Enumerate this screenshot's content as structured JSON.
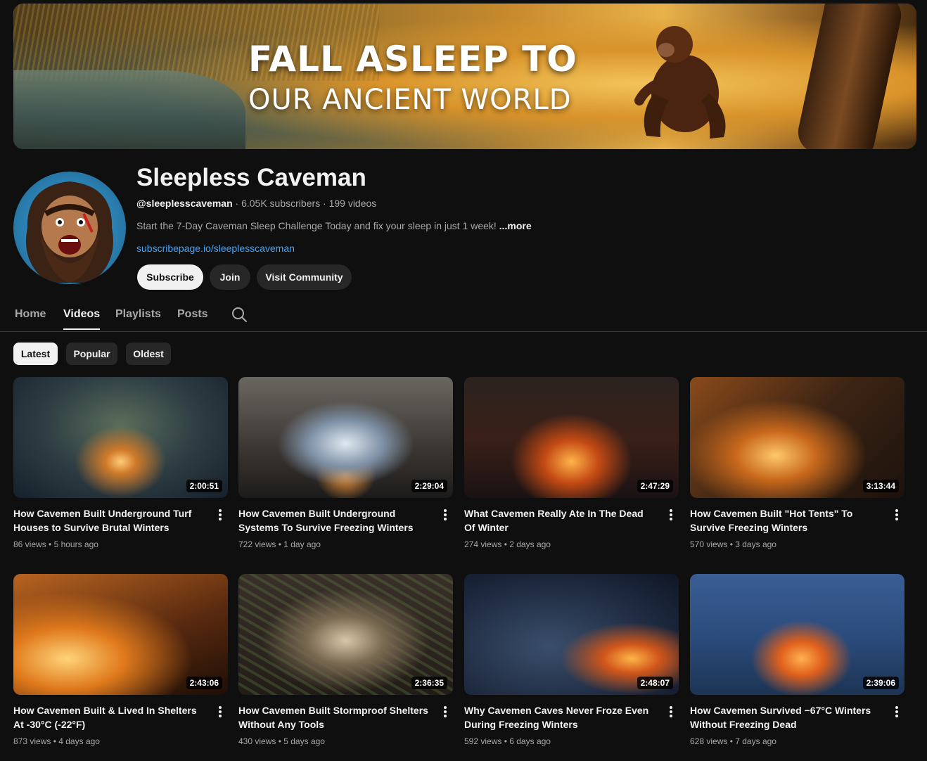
{
  "banner": {
    "line1": "FALL ASLEEP TO",
    "line2": "OUR ANCIENT WORLD"
  },
  "channel": {
    "name": "Sleepless Caveman",
    "handle": "@sleeplesscaveman",
    "stats": " · 6.05K subscribers · 199 videos",
    "description": "Start the 7-Day Caveman Sleep Challenge Today and fix your sleep in just 1 week! ",
    "more_label": "...more",
    "link": "subscribepage.io/sleeplesscaveman"
  },
  "buttons": {
    "subscribe": "Subscribe",
    "join": "Join",
    "community": "Visit Community"
  },
  "tabs": [
    "Home",
    "Videos",
    "Playlists",
    "Posts"
  ],
  "active_tab": "Videos",
  "chips": [
    "Latest",
    "Popular",
    "Oldest"
  ],
  "active_chip": "Latest",
  "videos": [
    {
      "title": "How Cavemen Built Underground Turf Houses to Survive Brutal Winters",
      "views": "86 views",
      "age": "5 hours ago",
      "duration": "2:00:51"
    },
    {
      "title": "How Cavemen Built Underground Systems To Survive Freezing Winters",
      "views": "722 views",
      "age": "1 day ago",
      "duration": "2:29:04"
    },
    {
      "title": "What Cavemen Really Ate In The Dead Of Winter",
      "views": "274 views",
      "age": "2 days ago",
      "duration": "2:47:29"
    },
    {
      "title": "How Cavemen Built \"Hot Tents\" To Survive Freezing Winters",
      "views": "570 views",
      "age": "3 days ago",
      "duration": "3:13:44"
    },
    {
      "title": "How Cavemen Built & Lived In Shelters At -30°C (-22°F)",
      "views": "873 views",
      "age": "4 days ago",
      "duration": "2:43:06"
    },
    {
      "title": "How Cavemen Built Stormproof Shelters Without Any Tools",
      "views": "430 views",
      "age": "5 days ago",
      "duration": "2:36:35"
    },
    {
      "title": "Why Cavemen Caves Never Froze Even During Freezing Winters",
      "views": "592 views",
      "age": "6 days ago",
      "duration": "2:48:07"
    },
    {
      "title": "How Cavemen Survived −67°C Winters Without Freezing Dead",
      "views": "628 views",
      "age": "7 days ago",
      "duration": "2:39:06"
    }
  ],
  "meta_separator": " • ",
  "colors": {
    "background": "#0f0f0f",
    "link": "#3ea6ff",
    "chip_bg": "#272727",
    "active_fg": "#f1f1f1"
  },
  "icons": {
    "search": "search-icon",
    "more": "more-vert-icon"
  }
}
